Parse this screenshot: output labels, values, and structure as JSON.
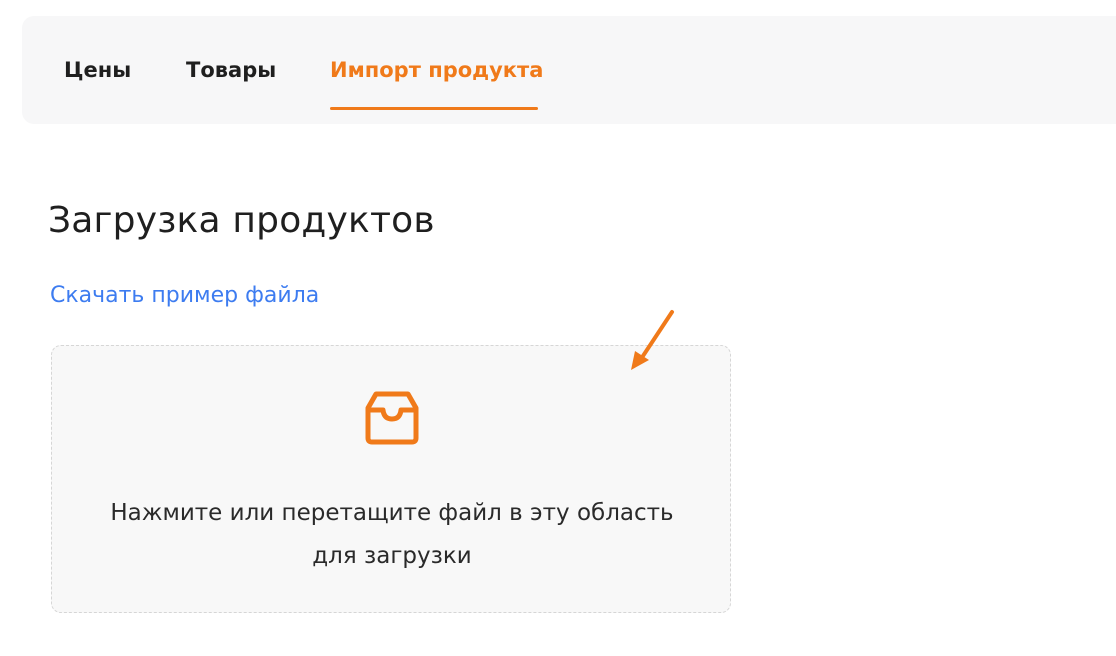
{
  "tabs": [
    {
      "label": "Цены",
      "active": false
    },
    {
      "label": "Товары",
      "active": false
    },
    {
      "label": "Импорт продукта",
      "active": true
    }
  ],
  "main": {
    "title": "Загрузка продуктов",
    "download_sample_link": "Скачать пример файла",
    "dropzone": {
      "icon": "inbox-icon",
      "text_line1": "Нажмите или перетащите файл в эту область",
      "text_line2": "для загрузки"
    }
  },
  "annotation": {
    "icon": "arrow-icon",
    "color": "#f07a1a"
  },
  "colors": {
    "accent": "#f07a1a",
    "link": "#3d7cf0",
    "tabs_background": "#f7f7f8",
    "dropzone_background": "#f8f8f8"
  }
}
